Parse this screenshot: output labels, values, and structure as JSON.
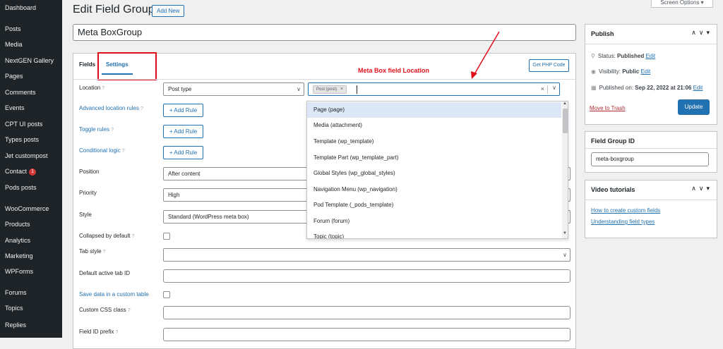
{
  "sidebar": {
    "items": [
      {
        "label": "Dashboard"
      },
      {
        "label": "Posts"
      },
      {
        "label": "Media"
      },
      {
        "label": "NextGEN Gallery"
      },
      {
        "label": "Pages"
      },
      {
        "label": "Comments"
      },
      {
        "label": "Events"
      },
      {
        "label": "CPT UI posts"
      },
      {
        "label": "Types posts"
      },
      {
        "label": "Jet custompost"
      },
      {
        "label": "Contact",
        "badge": "1"
      },
      {
        "label": "Pods posts"
      },
      {
        "label": "WooCommerce"
      },
      {
        "label": "Products"
      },
      {
        "label": "Analytics"
      },
      {
        "label": "Marketing"
      },
      {
        "label": "WPForms"
      },
      {
        "label": "Forums"
      },
      {
        "label": "Topics"
      },
      {
        "label": "Replies"
      }
    ]
  },
  "header": {
    "title": "Edit Field Group",
    "add_new": "Add New",
    "screen_options": "Screen Options ▾"
  },
  "title_field": {
    "value": "Meta BoxGroup"
  },
  "tabs": {
    "fields": "Fields",
    "settings": "Settings"
  },
  "annotation": "Meta Box field Location",
  "get_php_code": "Get PHP Code",
  "settings": {
    "location": {
      "label": "Location",
      "type_value": "Post type",
      "tag": "Post (post)",
      "tag_remove": "×",
      "clear": "×",
      "chevron": "∨"
    },
    "advanced_location_rules": "Advanced location rules",
    "toggle_rules": "Toggle rules",
    "conditional_logic": "Conditional logic",
    "add_rule": "+ Add Rule",
    "position": {
      "label": "Position",
      "value": "After content"
    },
    "priority": {
      "label": "Priority",
      "value": "High"
    },
    "style": {
      "label": "Style",
      "value": "Standard (WordPress meta box)"
    },
    "collapsed": "Collapsed by default",
    "tab_style": "Tab style",
    "default_active_tab": "Default active tab ID",
    "save_data_custom_table": "Save data in a custom table",
    "custom_css_class": "Custom CSS class",
    "field_id_prefix": "Field ID prefix",
    "help": "?"
  },
  "dropdown": {
    "options": [
      "Page (page)",
      "Media (attachment)",
      "Template (wp_template)",
      "Template Part (wp_template_part)",
      "Global Styles (wp_global_styles)",
      "Navigation Menu (wp_navigation)",
      "Pod Template (_pods_template)",
      "Forum (forum)",
      "Topic (topic)"
    ]
  },
  "publish": {
    "title": "Publish",
    "controls": "∧∨▾",
    "status_label": "Status:",
    "status_value": "Published",
    "visibility_label": "Visibility:",
    "visibility_value": "Public",
    "published_on_label": "Published on:",
    "published_on_value": "Sep 22, 2022 at 21:06",
    "edit": "Edit",
    "move_to_trash": "Move to Trash",
    "update": "Update"
  },
  "field_group_id": {
    "title": "Field Group ID",
    "value": "meta-boxgroup"
  },
  "video_tutorials": {
    "title": "Video tutorials",
    "links": [
      "How to create custom fields",
      "Understanding field types"
    ]
  },
  "colors": {
    "sidebar_bg": "#1d2327",
    "accent": "#2271b1",
    "annotation_red": "#e0101a",
    "badge_red": "#d63638"
  }
}
